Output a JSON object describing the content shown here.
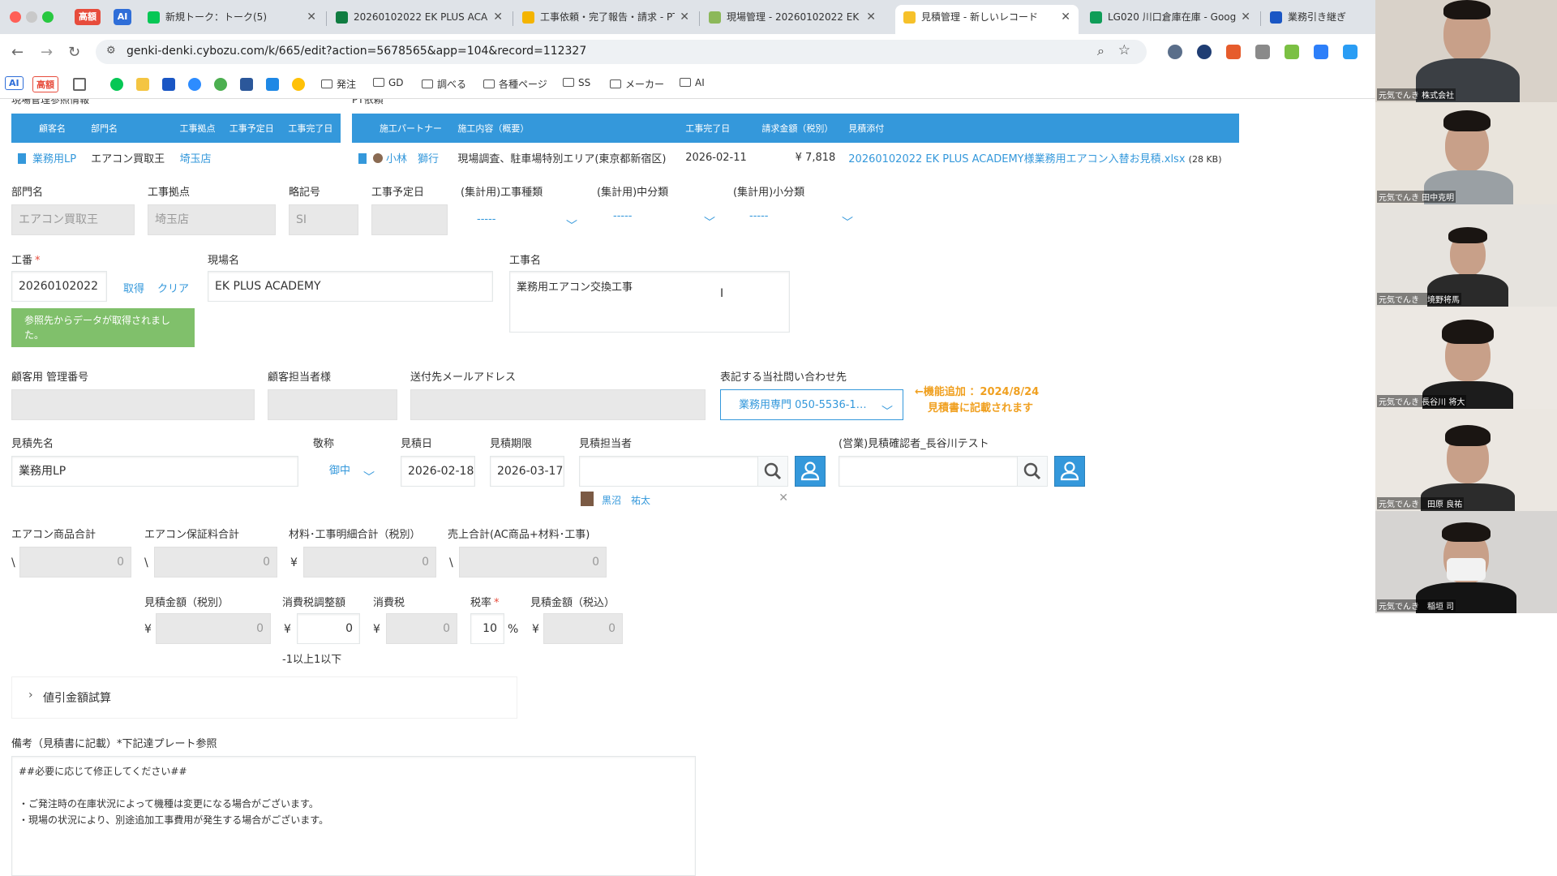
{
  "browser": {
    "pinned": [
      {
        "label": "高額",
        "color": "#e74c3c"
      },
      {
        "label": "AI",
        "color": "#2f6ed8"
      }
    ],
    "tabs": [
      {
        "label": "新規トーク：トーク(5)",
        "icon_color": "#06c755",
        "active": false
      },
      {
        "label": "20260102022 EK PLUS ACA",
        "icon_color": "#107c41",
        "active": false
      },
      {
        "label": "工事依頼・完了報告・請求 - PT",
        "icon_color": "#f4b400",
        "active": false
      },
      {
        "label": "現場管理 - 20260102022 EK P",
        "icon_color": "#8cb85a",
        "active": false
      },
      {
        "label": "見積管理 - 新しいレコード",
        "icon_color": "#f6c12a",
        "active": true
      },
      {
        "label": "LG020 川口倉庫在庫 - Goog",
        "icon_color": "#0f9d58",
        "active": false
      },
      {
        "label": "業務引き継ぎ",
        "icon_color": "#1a56c4",
        "active": false
      }
    ],
    "url": "genki-denki.cybozu.com/k/665/edit?action=5678565&app=104&record=112327",
    "bookmarks": [
      {
        "label": "AI",
        "type": "badge"
      },
      {
        "label": "高額",
        "type": "badge"
      },
      {
        "label": "発注",
        "type": "folder"
      },
      {
        "label": "GD",
        "type": "folder"
      },
      {
        "label": "調べる",
        "type": "folder"
      },
      {
        "label": "各種ページ",
        "type": "folder"
      },
      {
        "label": "SS",
        "type": "folder"
      },
      {
        "label": "メーカー",
        "type": "folder"
      },
      {
        "label": "AI",
        "type": "folder"
      }
    ]
  },
  "ref_tables": {
    "site_title": "現場管理参照情報",
    "site_headers": [
      "顧客名",
      "部門名",
      "工事拠点",
      "工事予定日",
      "工事完了日"
    ],
    "site_row": [
      "業務用LP",
      "エアコン買取王",
      "埼玉店",
      "",
      ""
    ],
    "pt_title": "PT依頼",
    "pt_headers": [
      "施工パートナー",
      "施工内容（概要）",
      "工事完了日",
      "請求金額（税別）",
      "見積添付"
    ],
    "pt_row": {
      "partner": "小林　獅行",
      "content": "現場調査、駐車場特別エリア(東京都新宿区)",
      "completed": "2026-02-11",
      "amount": "¥ 7,818",
      "attachment": "20260102022 EK PLUS ACADEMY様業務用エアコン入替お見積.xlsx",
      "attachment_size": "(28 KB)"
    }
  },
  "form": {
    "dept": {
      "label": "部門名",
      "value": "エアコン買取王"
    },
    "base": {
      "label": "工事拠点",
      "value": "埼玉店"
    },
    "abbr": {
      "label": "略記号",
      "value": "SI"
    },
    "sched": {
      "label": "工事予定日",
      "value": ""
    },
    "type1": {
      "label": "(集計用)工事種類",
      "value": "-----"
    },
    "type2": {
      "label": "(集計用)中分類",
      "value": "-----"
    },
    "type3": {
      "label": "(集計用)小分類",
      "value": "-----"
    },
    "kouban": {
      "label": "工番",
      "value": "20260102022",
      "get": "取得",
      "clear": "クリア"
    },
    "genba": {
      "label": "現場名",
      "value": "EK PLUS ACADEMY"
    },
    "kouji": {
      "label": "工事名",
      "value": "業務用エアコン交換工事"
    },
    "green_msg": "参照先からデータが取得されました。",
    "client_mgmt": {
      "label": "顧客用 管理番号",
      "value": ""
    },
    "client_person": {
      "label": "顧客担当者様",
      "value": ""
    },
    "mail": {
      "label": "送付先メールアドレス",
      "value": ""
    },
    "contact": {
      "label": "表記する当社問い合わせ先",
      "value": "業務用専門 050-5536-1…"
    },
    "notice1": "←機能追加 ：2024/8/24",
    "notice2": "見積書に記載されます",
    "mitsumori_saki": {
      "label": "見積先名",
      "value": "業務用LP"
    },
    "keisho": {
      "label": "敬称",
      "value": "御中"
    },
    "mitsumori_bi": {
      "label": "見積日",
      "value": "2026-02-18"
    },
    "kigen": {
      "label": "見積期限",
      "value": "2026-03-17"
    },
    "tantou": {
      "label": "見積担当者",
      "value": "",
      "selected": "黒沼　祐太"
    },
    "kakunin": {
      "label": "(営業)見積確認者_長谷川テスト",
      "value": ""
    },
    "ac_total": {
      "label": "エアコン商品合計",
      "cur": "\\",
      "value": "0"
    },
    "warranty": {
      "label": "エアコン保証料合計",
      "cur": "\\",
      "value": "0"
    },
    "material": {
      "label": "材料･工事明細合計（税別）",
      "cur": "¥",
      "value": "0"
    },
    "sales": {
      "label": "売上合計(AC商品+材料･工事)",
      "cur": "\\",
      "value": "0"
    },
    "amount_ex": {
      "label": "見積金額（税別）",
      "cur": "¥",
      "value": "0"
    },
    "tax_adj": {
      "label": "消費税調整額",
      "cur": "¥",
      "value": "0",
      "hint": "-1以上1以下"
    },
    "tax": {
      "label": "消費税",
      "cur": "¥",
      "value": "0"
    },
    "rate": {
      "label": "税率",
      "value": "10",
      "unit": "%"
    },
    "amount_in": {
      "label": "見積金額（税込）",
      "cur": "¥",
      "value": "0"
    },
    "discount": "値引金額試算",
    "remarks": {
      "label": "備考（見積書に記載）*下記達プレート参照",
      "lines": [
        "##必要に応じて修正してください##",
        "",
        "・ご発注時の在庫状況によって機種は変更になる場合がございます。",
        "・現場の状況により、別途追加工事費用が発生する場合がございます。"
      ]
    }
  },
  "participants": [
    {
      "name": "元気でんき 株式会社"
    },
    {
      "name": "元気でんき 田中克明"
    },
    {
      "name": "元気でんき　境野将馬"
    },
    {
      "name": "元気でんき 長谷川 将大"
    },
    {
      "name": "元気でんき　田原 良祐"
    },
    {
      "name": "元気でんき　稲垣 司"
    }
  ]
}
